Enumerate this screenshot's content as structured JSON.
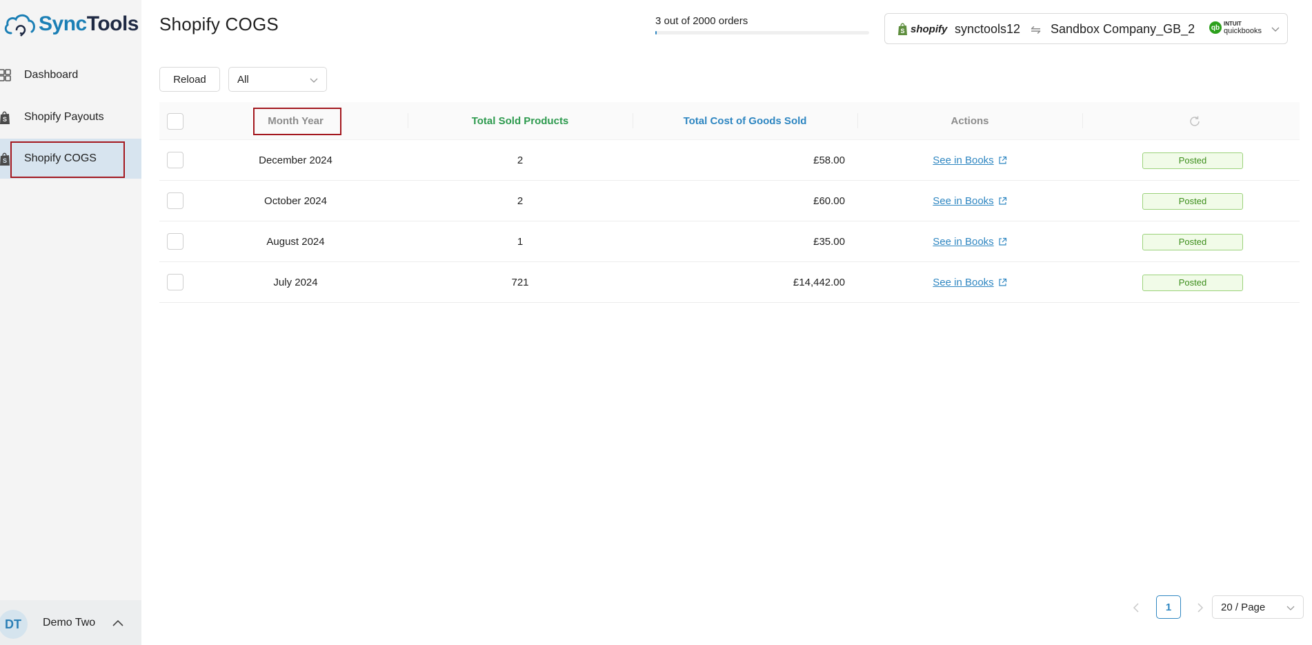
{
  "brand": {
    "name_part1": "Sync",
    "name_part2": "Tools"
  },
  "sidebar": {
    "items": [
      {
        "label": "Dashboard",
        "icon": "dashboard-grid-icon"
      },
      {
        "label": "Shopify Payouts",
        "icon": "shopify-bag-icon"
      },
      {
        "label": "Shopify COGS",
        "icon": "shopify-bag-icon",
        "active": true
      }
    ],
    "user": {
      "initials": "DT",
      "name": "Demo Two"
    }
  },
  "header": {
    "title": "Shopify COGS",
    "progress_text": "3 out of 2000 orders",
    "progress_fraction": 0.0015
  },
  "connection": {
    "shopify_word": "shopify",
    "store": "synctools12",
    "swap_symbol": "⇋",
    "company": "Sandbox Company_GB_2",
    "qb_intuit": "INTUIT",
    "qb_word": "quickbooks",
    "qb_mark": "qb"
  },
  "toolbar": {
    "reload_label": "Reload",
    "filter_value": "All"
  },
  "table": {
    "columns": {
      "month_year": "Month Year",
      "total_sold": "Total Sold Products",
      "total_cost": "Total Cost of Goods Sold",
      "actions": "Actions"
    },
    "rows": [
      {
        "month_year": "December 2024",
        "total_sold": "2",
        "total_cost": "£58.00",
        "action": "See in Books",
        "status": "Posted"
      },
      {
        "month_year": "October 2024",
        "total_sold": "2",
        "total_cost": "£60.00",
        "action": "See in Books",
        "status": "Posted"
      },
      {
        "month_year": "August 2024",
        "total_sold": "1",
        "total_cost": "£35.00",
        "action": "See in Books",
        "status": "Posted"
      },
      {
        "month_year": "July 2024",
        "total_sold": "721",
        "total_cost": "£14,442.00",
        "action": "See in Books",
        "status": "Posted"
      }
    ]
  },
  "pagination": {
    "current_page": "1",
    "page_size": "20 / Page"
  },
  "colors": {
    "accent_blue": "#2e86c1",
    "green_header": "#2d9a4e",
    "posted_green": "#3b8d1a",
    "highlight_red": "#a3171e"
  }
}
